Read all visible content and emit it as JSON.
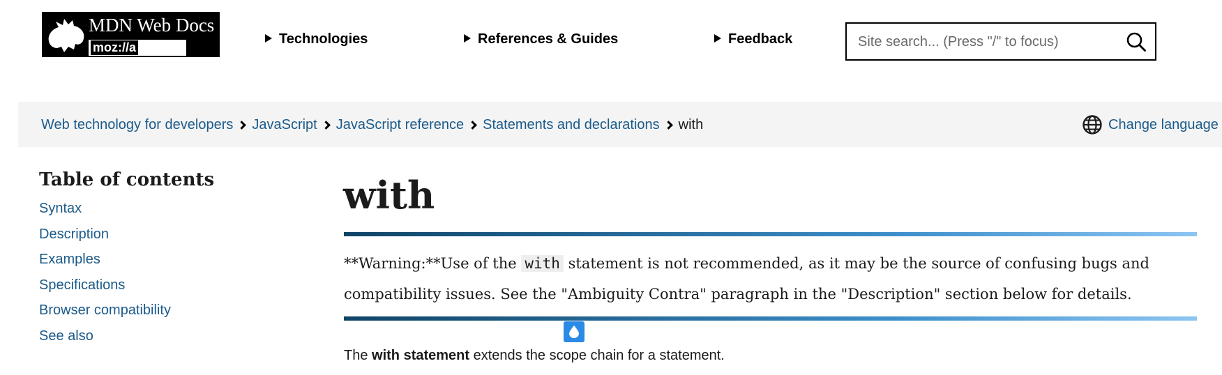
{
  "header": {
    "logo": {
      "title": "MDN Web Docs",
      "subtitle": "moz://a"
    },
    "nav": [
      {
        "label": "Technologies"
      },
      {
        "label": "References & Guides"
      },
      {
        "label": "Feedback"
      }
    ],
    "search": {
      "placeholder": "Site search... (Press \"/\" to focus)",
      "value": ""
    }
  },
  "breadcrumb": {
    "items": [
      {
        "label": "Web technology for developers"
      },
      {
        "label": "JavaScript"
      },
      {
        "label": "JavaScript reference"
      },
      {
        "label": "Statements and declarations"
      }
    ],
    "current": "with",
    "language_label": "Change language"
  },
  "toc": {
    "title": "Table of contents",
    "items": [
      {
        "label": "Syntax"
      },
      {
        "label": "Description"
      },
      {
        "label": "Examples"
      },
      {
        "label": "Specifications"
      },
      {
        "label": "Browser compatibility"
      },
      {
        "label": "See also"
      }
    ]
  },
  "article": {
    "title": "with",
    "warning": {
      "prefix": "**Warning:**Use of the ",
      "code": "with",
      "suffix": " statement is not recommended, as it may be the source of confusing bugs and compatibility issues. See the \"Ambiguity Contra\" paragraph in the \"Description\" section below for details."
    },
    "intro": {
      "before": "The ",
      "strong": "with statement",
      "after": " extends the scope chain for a statement."
    }
  },
  "colors": {
    "link": "#1b5a8a",
    "breadcrumb_bg": "#f4f4f4",
    "drop_badge": "#2a8ae6",
    "gradient_start": "#0e4366",
    "gradient_end": "#8cc5f2"
  },
  "icons": [
    "mdn-dino-logo",
    "search-icon",
    "globe-icon",
    "water-drop-icon"
  ]
}
